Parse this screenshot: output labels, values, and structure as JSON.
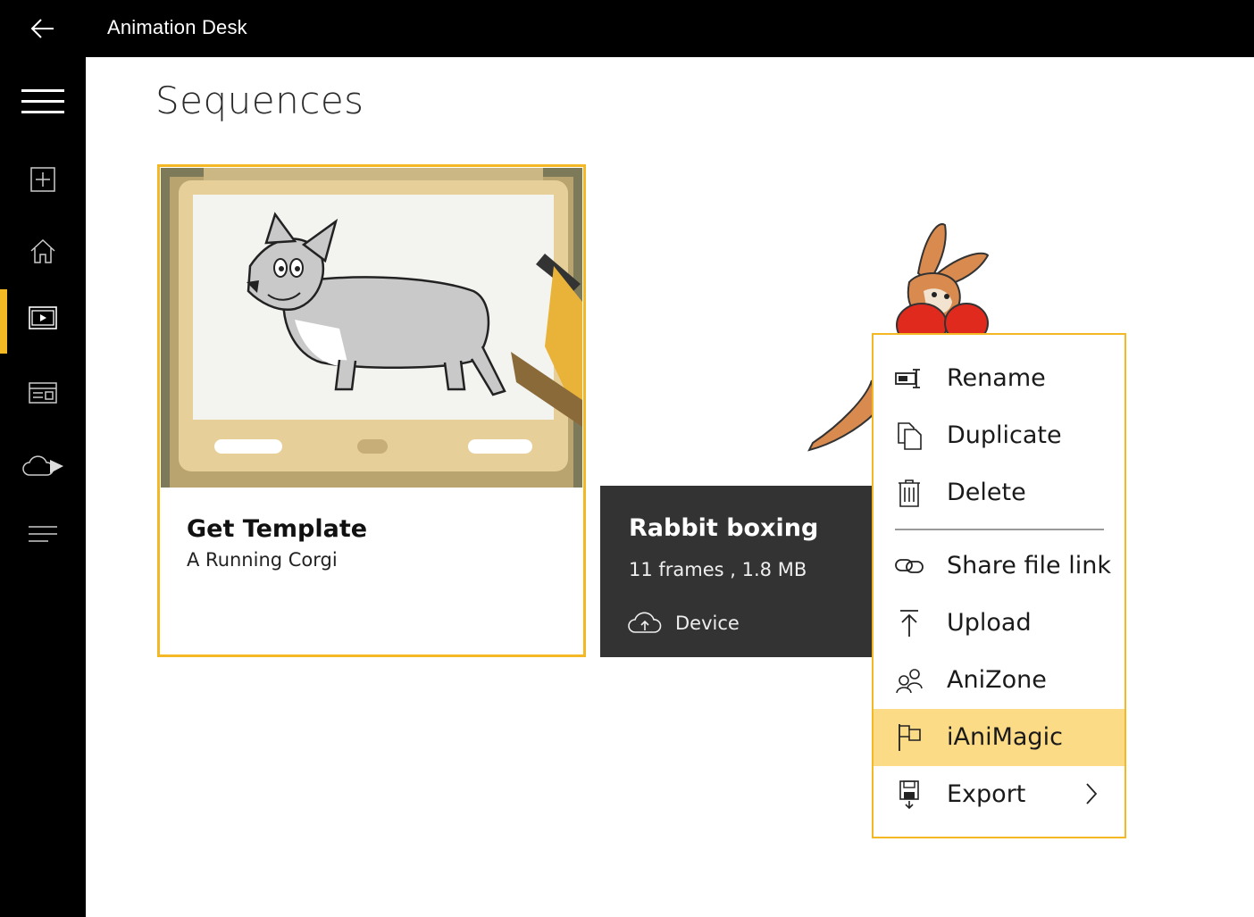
{
  "app": {
    "title": "Animation Desk"
  },
  "page": {
    "title": "Sequences"
  },
  "sidebar": {
    "items": [
      {
        "name": "menu",
        "icon": "hamburger-icon"
      },
      {
        "name": "new",
        "icon": "add-box-icon"
      },
      {
        "name": "home",
        "icon": "home-icon"
      },
      {
        "name": "sequences",
        "icon": "sequence-icon",
        "active": true
      },
      {
        "name": "gallery",
        "icon": "gallery-icon"
      },
      {
        "name": "cloud",
        "icon": "cloud-download-icon"
      },
      {
        "name": "more",
        "icon": "list-icon"
      }
    ]
  },
  "cards": {
    "template": {
      "title": "Get Template",
      "subtitle": "A Running Corgi"
    },
    "rabbit": {
      "title": "Rabbit boxing",
      "meta": "11 frames ,  1.8 MB",
      "location": "Device"
    }
  },
  "context_menu": {
    "items": [
      {
        "label": "Rename",
        "icon": "rename-icon"
      },
      {
        "label": "Duplicate",
        "icon": "duplicate-icon"
      },
      {
        "label": "Delete",
        "icon": "trash-icon"
      },
      {
        "label": "Share file link",
        "icon": "link-icon"
      },
      {
        "label": "Upload",
        "icon": "upload-icon"
      },
      {
        "label": "AniZone",
        "icon": "people-icon"
      },
      {
        "label": "iAniMagic",
        "icon": "flag-icon",
        "highlighted": true
      },
      {
        "label": "Export",
        "icon": "save-icon",
        "submenu": true
      }
    ]
  },
  "colors": {
    "accent": "#F3B824",
    "highlight": "#FCDB86",
    "chrome": "#000000",
    "card_dark": "#333333"
  }
}
